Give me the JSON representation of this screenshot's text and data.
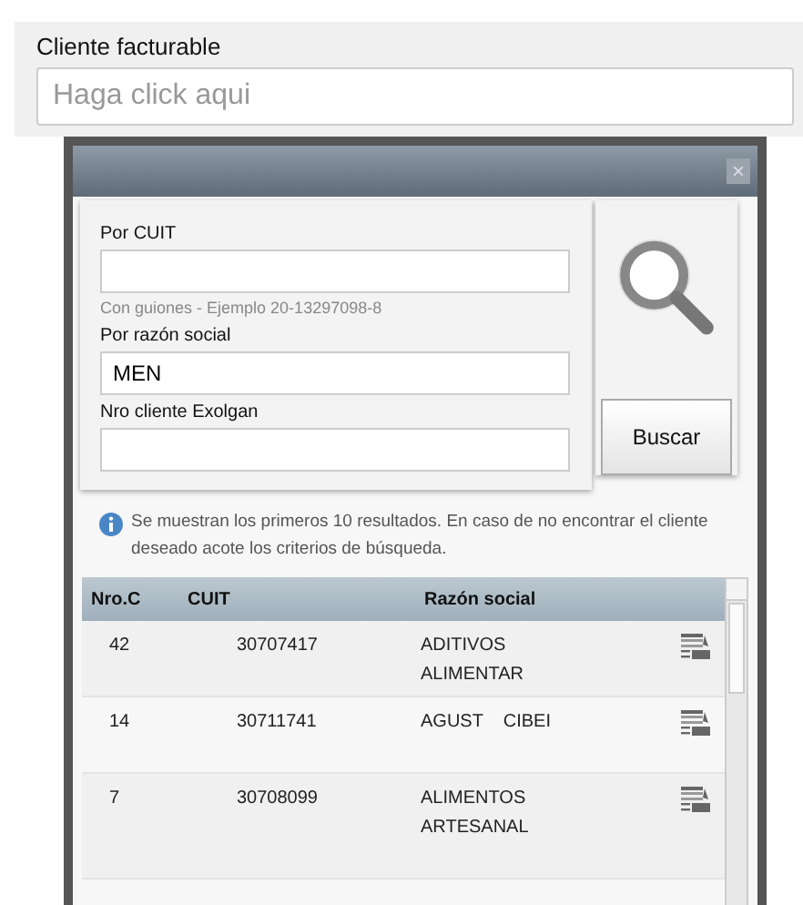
{
  "field": {
    "label": "Cliente facturable",
    "placeholder": "Haga click aqui"
  },
  "dialog": {
    "close": "×",
    "search": {
      "fields": [
        {
          "label": "Por CUIT",
          "hint": "Con guiones - Ejemplo 20-13297098-8"
        },
        {
          "label": "Por razón social",
          "value": "MEN"
        },
        {
          "label": "Nro cliente Exolgan"
        }
      ],
      "button": "Buscar"
    },
    "info": "Se muestran los primeros 10 resultados. En caso de no encontrar el cliente deseado acote los criterios de búsqueda.",
    "table": {
      "columns": [
        "Nro.C",
        "CUIT",
        "Razón social"
      ],
      "rows": [
        {
          "nro": "42",
          "cuit": "30707417",
          "razon": "ADITIVOS ALIMENTAR"
        },
        {
          "nro": "14",
          "cuit": "30711741",
          "razon": "AGUST    CIBEI"
        },
        {
          "nro": "7",
          "cuit": "30708099",
          "razon": "ALIMENTOS ARTESANAL"
        }
      ]
    }
  }
}
